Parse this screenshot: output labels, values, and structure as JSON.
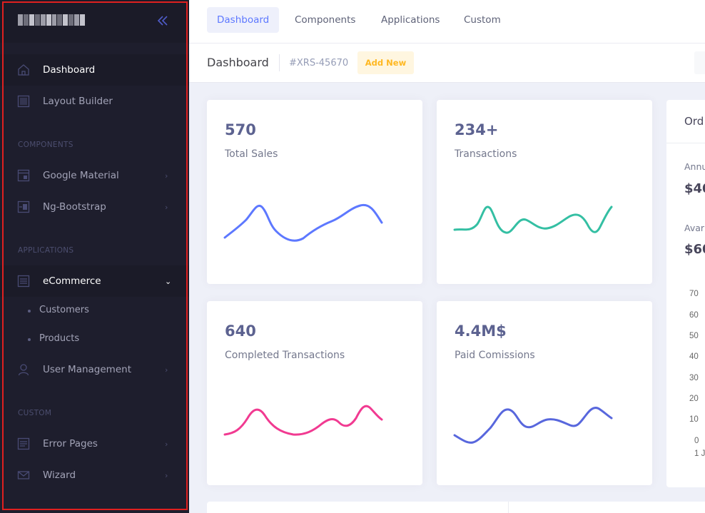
{
  "topnav": {
    "tabs": [
      {
        "label": "Dashboard",
        "active": true
      },
      {
        "label": "Components"
      },
      {
        "label": "Applications"
      },
      {
        "label": "Custom"
      }
    ]
  },
  "subheader": {
    "title": "Dashboard",
    "code": "#XRS-45670",
    "add_new": "Add New"
  },
  "sidebar": {
    "items": {
      "dashboard": "Dashboard",
      "layout_builder": "Layout Builder",
      "google_material": "Google Material",
      "ng_bootstrap": "Ng-Bootstrap",
      "ecommerce": "eCommerce",
      "customers": "Customers",
      "products": "Products",
      "user_management": "User Management",
      "error_pages": "Error Pages",
      "wizard": "Wizard"
    },
    "sections": {
      "components": "COMPONENTS",
      "applications": "APPLICATIONS",
      "custom": "CUSTOM"
    }
  },
  "stats": [
    {
      "value": "570",
      "label": "Total Sales",
      "color": "#5d78ff"
    },
    {
      "value": "234+",
      "label": "Transactions",
      "color": "#34bfa3"
    },
    {
      "value": "640",
      "label": "Completed Transactions",
      "color": "#f13a91"
    },
    {
      "value": "4.4M$",
      "label": "Paid Comissions",
      "color": "#5867dd"
    }
  ],
  "orders": {
    "title": "Ord",
    "annual_label": "Annu",
    "annual_value": "$40",
    "avg_label": "Avar",
    "avg_value": "$60",
    "ticks": [
      "70",
      "60",
      "50",
      "40",
      "30",
      "20",
      "10",
      "0"
    ],
    "x_tick": "1 J"
  },
  "colors": {
    "sidebar_bg": "#1e1e2d",
    "accent": "#5d78ff",
    "warning": "#ffb822"
  }
}
